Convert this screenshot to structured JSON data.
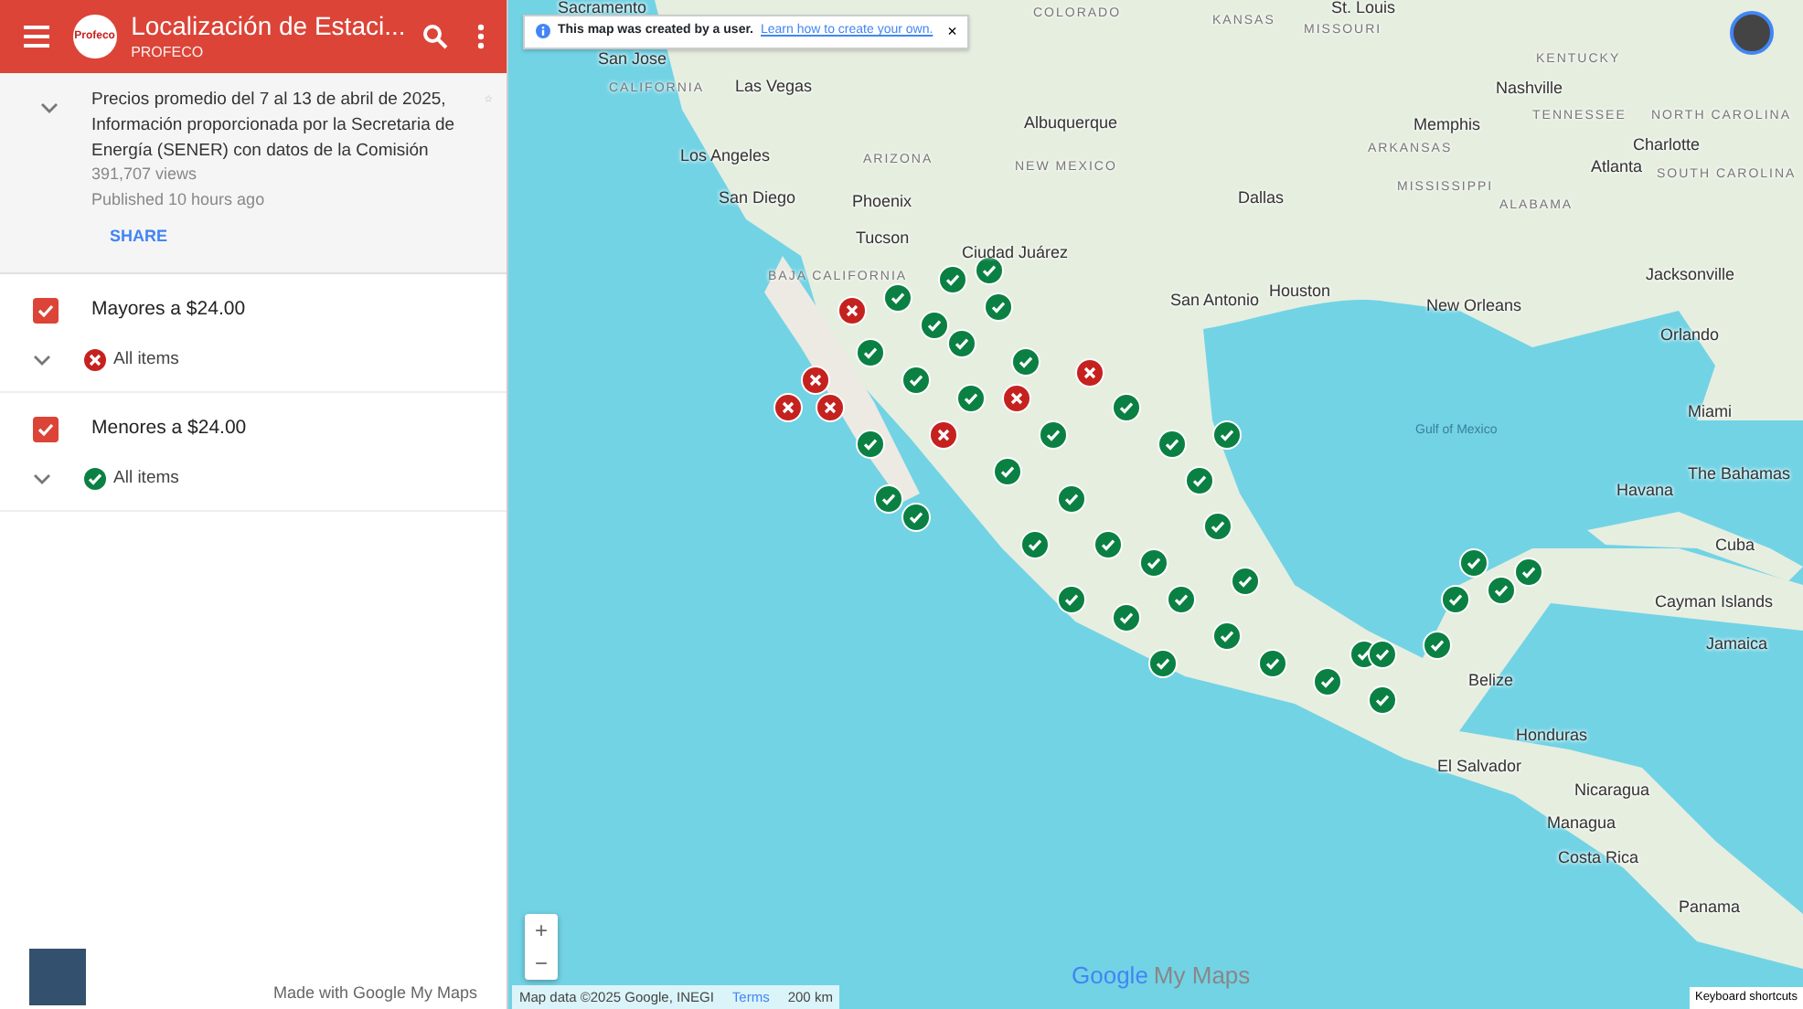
{
  "header": {
    "title": "Localización de Estaci...",
    "subtitle": "PROFECO",
    "logo_text": "Profeco"
  },
  "map_info": {
    "description": "Precios promedio del 7 al 13 de abril de 2025, Información proporcionada por la Secretaria de Energía (SENER) con datos de la Comisión",
    "views": "391,707 views",
    "published": "Published 10 hours ago",
    "share": "SHARE",
    "starred": false
  },
  "layers": [
    {
      "name": "Mayores a $24.00",
      "checked": true,
      "item_label": "All items",
      "kind": "cross",
      "color": "#c5221f"
    },
    {
      "name": "Menores a $24.00",
      "checked": true,
      "item_label": "All items",
      "kind": "check",
      "color": "#0b8043"
    }
  ],
  "footer": {
    "made_with": "Made with Google My Maps"
  },
  "notice": {
    "text": "This map was created by a user.",
    "link": "Learn how to create your own.",
    "close": "×"
  },
  "map_labels": [
    {
      "text": "Sacramento",
      "kind": "city"
    },
    {
      "text": "San Jose",
      "kind": "city"
    },
    {
      "text": "CALIFORNIA",
      "kind": "region"
    },
    {
      "text": "Las Vegas",
      "kind": "city"
    },
    {
      "text": "COLORADO",
      "kind": "region"
    },
    {
      "text": "KANSAS",
      "kind": "region"
    },
    {
      "text": "Albuquerque",
      "kind": "city"
    },
    {
      "text": "Los Angeles",
      "kind": "city"
    },
    {
      "text": "ARIZONA",
      "kind": "region"
    },
    {
      "text": "NEW MEXICO",
      "kind": "region"
    },
    {
      "text": "San Diego",
      "kind": "city"
    },
    {
      "text": "Phoenix",
      "kind": "city"
    },
    {
      "text": "Dallas",
      "kind": "city"
    },
    {
      "text": "Tucson",
      "kind": "city"
    },
    {
      "text": "Ciudad Juárez",
      "kind": "city"
    },
    {
      "text": "BAJA CALIFORNIA",
      "kind": "region"
    },
    {
      "text": "San Antonio",
      "kind": "city"
    },
    {
      "text": "Houston",
      "kind": "city"
    },
    {
      "text": "New Orleans",
      "kind": "city"
    },
    {
      "text": "St. Louis",
      "kind": "city"
    },
    {
      "text": "MISSOURI",
      "kind": "region"
    },
    {
      "text": "KENTUCKY",
      "kind": "region"
    },
    {
      "text": "Nashville",
      "kind": "city"
    },
    {
      "text": "TENNESSEE",
      "kind": "region"
    },
    {
      "text": "Memphis",
      "kind": "city"
    },
    {
      "text": "ARKANSAS",
      "kind": "region"
    },
    {
      "text": "NORTH CAROLINA",
      "kind": "region"
    },
    {
      "text": "Charlotte",
      "kind": "city"
    },
    {
      "text": "Atlanta",
      "kind": "city"
    },
    {
      "text": "SOUTH CAROLINA",
      "kind": "region"
    },
    {
      "text": "MISSISSIPPI",
      "kind": "region"
    },
    {
      "text": "ALABAMA",
      "kind": "region"
    },
    {
      "text": "Jacksonville",
      "kind": "city"
    },
    {
      "text": "Orlando",
      "kind": "city"
    },
    {
      "text": "Miami",
      "kind": "city"
    },
    {
      "text": "Gulf of Mexico",
      "kind": "water"
    },
    {
      "text": "Havana",
      "kind": "city"
    },
    {
      "text": "The Bahamas",
      "kind": "city"
    },
    {
      "text": "Cuba",
      "kind": "city"
    },
    {
      "text": "Cayman Islands",
      "kind": "city"
    },
    {
      "text": "Jamaica",
      "kind": "city"
    },
    {
      "text": "Belize",
      "kind": "city"
    },
    {
      "text": "Honduras",
      "kind": "city"
    },
    {
      "text": "El Salvador",
      "kind": "city"
    },
    {
      "text": "Nicaragua",
      "kind": "city"
    },
    {
      "text": "Managua",
      "kind": "city"
    },
    {
      "text": "Costa Rica",
      "kind": "city"
    },
    {
      "text": "Panama",
      "kind": "city"
    }
  ],
  "zoom": {
    "in": "+",
    "out": "−"
  },
  "attribution": {
    "data": "Map data ©2025 Google, INEGI",
    "terms": "Terms",
    "scale": "200 km",
    "shortcuts": "Keyboard shortcuts"
  },
  "brand": {
    "google": "Google",
    "product": "My Maps"
  }
}
